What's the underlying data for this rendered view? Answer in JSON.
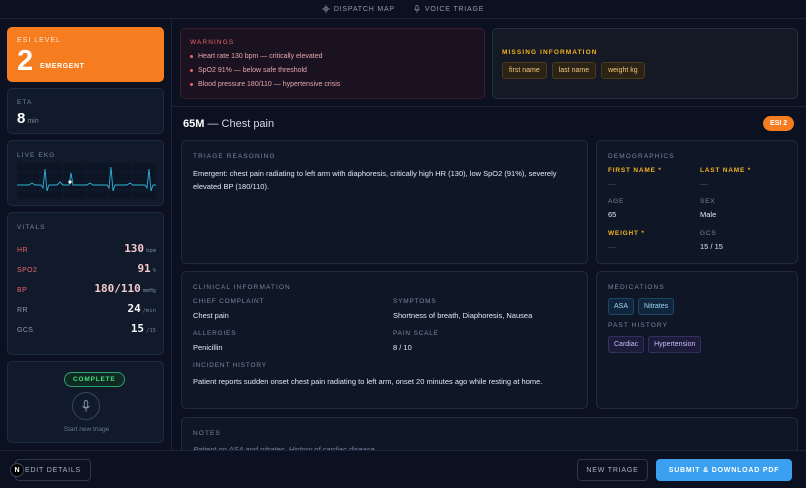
{
  "nav": {
    "dispatch_map": "DISPATCH MAP",
    "voice_triage": "VOICE TRIAGE"
  },
  "esi": {
    "label": "ESI LEVEL",
    "level": "2",
    "word": "EMERGENT",
    "color": "#f57c1f"
  },
  "eta": {
    "label": "ETA",
    "value": "8",
    "unit": "min"
  },
  "ekg": {
    "label": "LIVE EKG"
  },
  "vitals": {
    "label": "VITALS",
    "rows": [
      {
        "key": "HR",
        "value": "130",
        "unit": "bpm",
        "status": "alert"
      },
      {
        "key": "SPO2",
        "value": "91",
        "unit": "%",
        "status": "alert"
      },
      {
        "key": "BP",
        "value": "180/110",
        "unit": "mmHg",
        "status": "alert"
      },
      {
        "key": "RR",
        "value": "24",
        "unit": "/min",
        "status": "normal"
      },
      {
        "key": "GCS",
        "value": "15",
        "unit": "/15",
        "status": "normal"
      }
    ]
  },
  "voice": {
    "status": "COMPLETE",
    "hint": "Start new triage",
    "icon": "microphone-icon"
  },
  "warnings": {
    "label": "WARNINGS",
    "items": [
      "Heart rate 130 bpm — critically elevated",
      "SpO2 91% — below safe threshold",
      "Blood pressure 180/110 — hypertensive crisis"
    ]
  },
  "missing": {
    "label": "MISSING INFORMATION",
    "items": [
      "first name",
      "last name",
      "weight kg"
    ]
  },
  "patient": {
    "summary_bold": "65M",
    "summary_rest": "— Chest pain",
    "esi_badge": "ESI 2"
  },
  "triage_reasoning": {
    "label": "TRIAGE REASONING",
    "text": "Emergent: chest pain radiating to left arm with diaphoresis, critically high HR (130), low SpO2 (91%), severely elevated BP (180/110)."
  },
  "demographics": {
    "label": "DEMOGRAPHICS",
    "first_name_label": "FIRST NAME *",
    "first_name": "—",
    "last_name_label": "LAST NAME *",
    "last_name": "—",
    "age_label": "AGE",
    "age": "65",
    "sex_label": "SEX",
    "sex": "Male",
    "weight_label": "WEIGHT *",
    "weight": "—",
    "gcs_label": "GCS",
    "gcs": "15 / 15"
  },
  "clinical": {
    "label": "CLINICAL INFORMATION",
    "chief_complaint_label": "CHIEF COMPLAINT",
    "chief_complaint": "Chest pain",
    "symptoms_label": "SYMPTOMS",
    "symptoms": "Shortness of breath, Diaphoresis, Nausea",
    "allergies_label": "ALLERGIES",
    "allergies": "Penicillin",
    "pain_scale_label": "PAIN SCALE",
    "pain_scale": "8 / 10",
    "incident_history_label": "INCIDENT HISTORY",
    "incident_history": "Patient reports sudden onset chest pain radiating to left arm, onset 20 minutes ago while resting at home."
  },
  "medications": {
    "label": "MEDICATIONS",
    "items": [
      "ASA",
      "Nitrates"
    ],
    "past_history_label": "PAST HISTORY",
    "past_history": [
      "Cardiac",
      "Hypertension"
    ]
  },
  "notes": {
    "label": "NOTES",
    "text": "Patient on ASA and nitrates. History of cardiac disease."
  },
  "footer": {
    "edit_details": "EDIT DETAILS",
    "new_triage": "NEW TRIAGE",
    "submit": "SUBMIT & DOWNLOAD PDF",
    "logo_letter": "N"
  }
}
